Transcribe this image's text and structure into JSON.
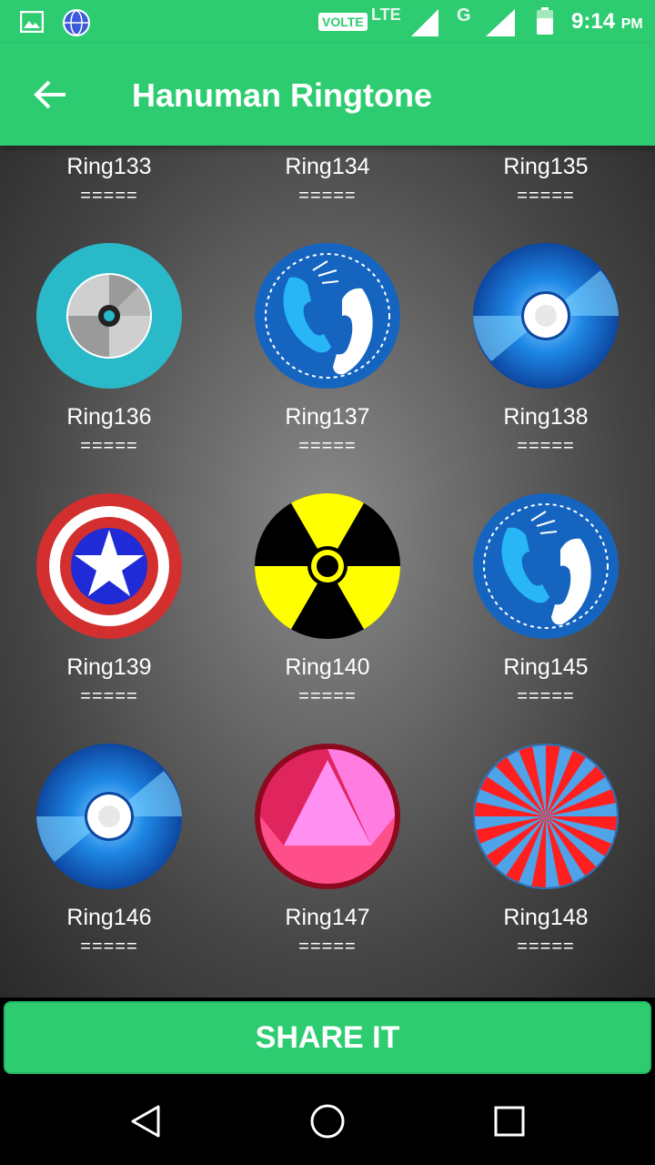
{
  "status_bar": {
    "volte": "VOLTE",
    "lte": "LTE",
    "network_g": "G",
    "time": "9:14",
    "ampm": "PM",
    "icons": [
      "gallery-icon",
      "news-icon",
      "signal-icon",
      "battery-icon"
    ]
  },
  "app_bar": {
    "title": "Hanuman Ringtone",
    "back_icon": "arrow-left-icon"
  },
  "grid": {
    "top_row": [
      {
        "label": "Ring133",
        "sep": "====="
      },
      {
        "label": "Ring134",
        "sep": "====="
      },
      {
        "label": "Ring135",
        "sep": "====="
      }
    ],
    "items": [
      {
        "label": "Ring136",
        "sep": "=====",
        "icon": "disc-teal-icon"
      },
      {
        "label": "Ring137",
        "sep": "=====",
        "icon": "phone-call-icon"
      },
      {
        "label": "Ring138",
        "sep": "=====",
        "icon": "cd-blue-icon"
      },
      {
        "label": "Ring139",
        "sep": "=====",
        "icon": "captain-shield-icon"
      },
      {
        "label": "Ring140",
        "sep": "=====",
        "icon": "radiation-icon"
      },
      {
        "label": "Ring145",
        "sep": "=====",
        "icon": "phone-call-icon"
      },
      {
        "label": "Ring146",
        "sep": "=====",
        "icon": "cd-blue-icon"
      },
      {
        "label": "Ring147",
        "sep": "=====",
        "icon": "pink-triangle-gem-icon"
      },
      {
        "label": "Ring148",
        "sep": "=====",
        "icon": "red-blue-swirl-icon"
      }
    ]
  },
  "share_button": {
    "label": "SHARE IT"
  },
  "nav_bar": {
    "icons": [
      "back-triangle-icon",
      "home-circle-icon",
      "recents-square-icon"
    ]
  },
  "colors": {
    "accent": "#2ecc71",
    "text": "#ffffff"
  }
}
